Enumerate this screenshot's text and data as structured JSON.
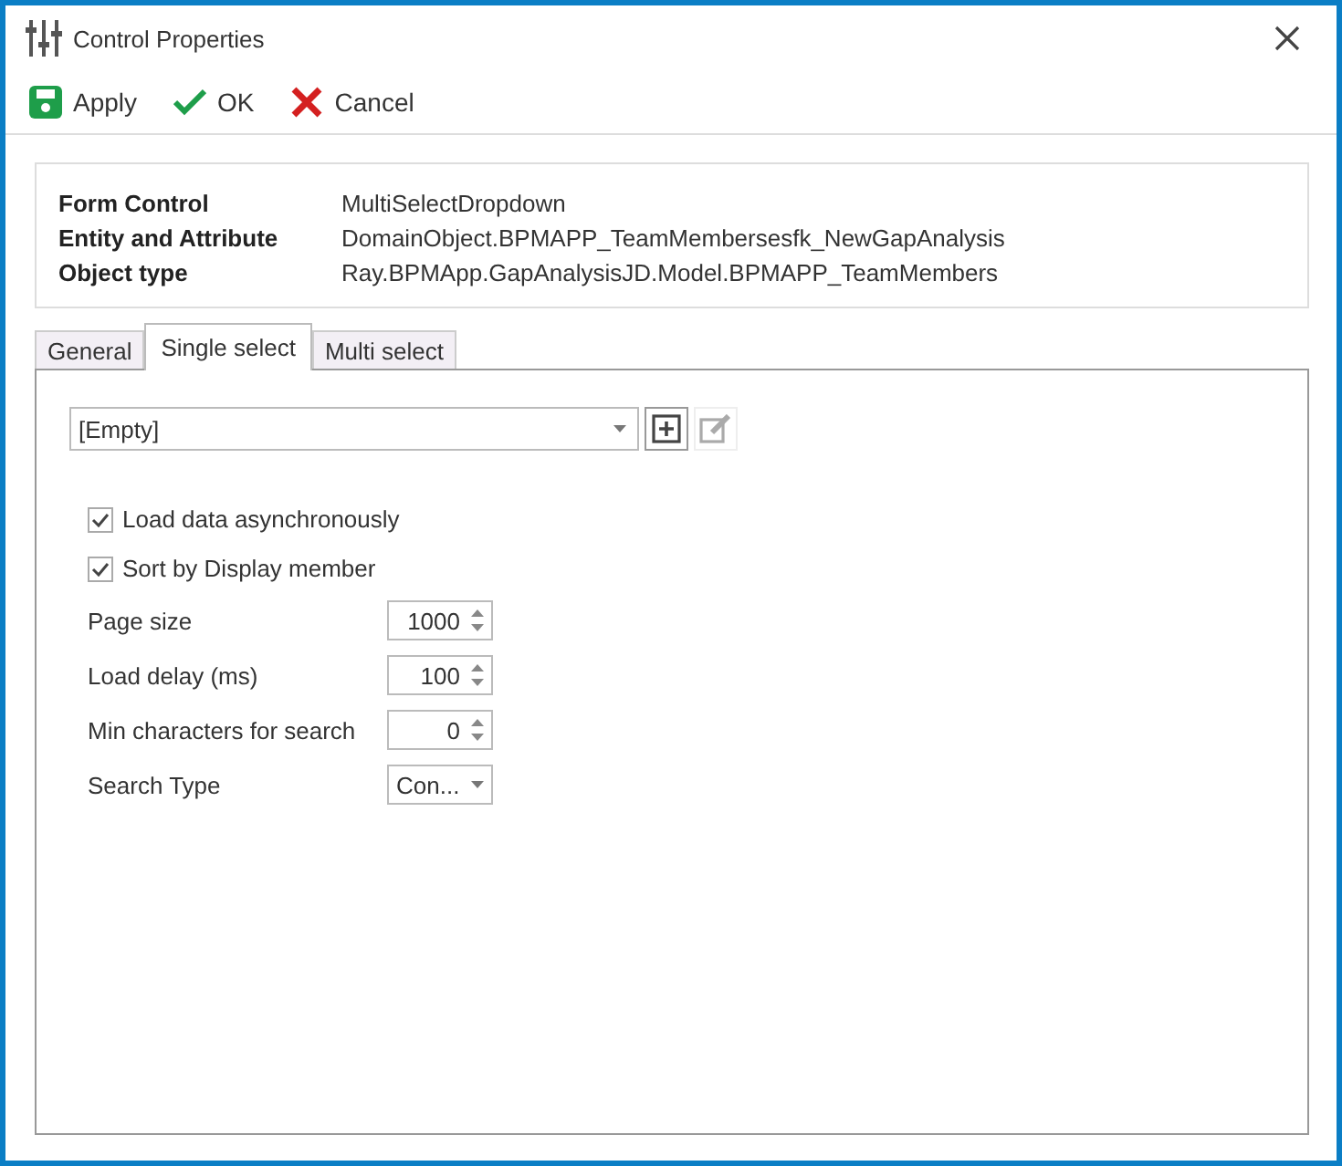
{
  "window": {
    "title": "Control Properties"
  },
  "toolbar": [
    {
      "kind": "save",
      "label": "Apply"
    },
    {
      "kind": "ok",
      "label": "OK"
    },
    {
      "kind": "cancel",
      "label": "Cancel"
    }
  ],
  "info": [
    {
      "label": "Form Control",
      "value": "MultiSelectDropdown"
    },
    {
      "label": "Entity and Attribute",
      "value": "DomainObject.BPMAPP_TeamMembersesfk_NewGapAnalysis"
    },
    {
      "label": "Object type",
      "value": "Ray.BPMApp.GapAnalysisJD.Model.BPMAPP_TeamMembers"
    }
  ],
  "tabs": [
    {
      "label": "General",
      "selected": false
    },
    {
      "label": "Single select",
      "selected": true
    },
    {
      "label": "Multi select",
      "selected": false
    }
  ],
  "source": {
    "value": "[Empty]"
  },
  "settings": [
    {
      "kind": "checkbox",
      "label": "Load data asynchronously",
      "checked": true
    },
    {
      "kind": "checkbox",
      "label": "Sort by Display member",
      "checked": true
    },
    {
      "kind": "spinner",
      "label": "Page size",
      "value": "1000"
    },
    {
      "kind": "spinner",
      "label": "Load delay (ms)",
      "value": "100"
    },
    {
      "kind": "spinner",
      "label": "Min characters for search",
      "value": "0"
    },
    {
      "kind": "dropdown",
      "label": "Search Type",
      "value": "Con..."
    }
  ]
}
